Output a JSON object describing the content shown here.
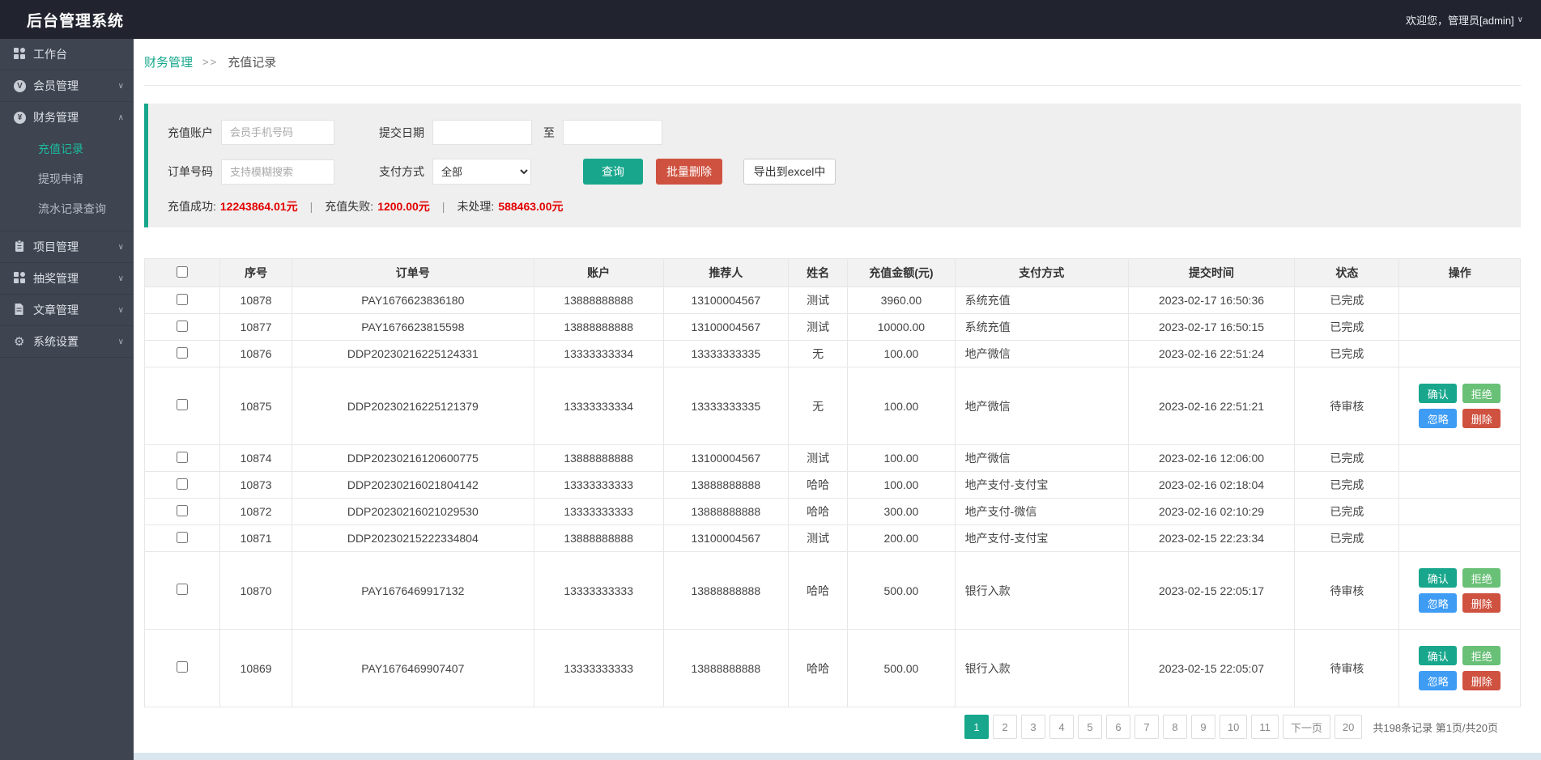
{
  "header": {
    "title": "后台管理系统",
    "welcome": "欢迎您，管理员[admin]"
  },
  "sidebar": {
    "items": [
      {
        "key": "workbench",
        "icon": "grid",
        "label": "工作台",
        "chevron": ""
      },
      {
        "key": "members",
        "icon": "member-circle",
        "label": "会员管理",
        "chevron": "down"
      },
      {
        "key": "finance",
        "icon": "yen-circle",
        "label": "财务管理",
        "chevron": "up",
        "children": [
          {
            "key": "recharge-records",
            "label": "充值记录",
            "active": true
          },
          {
            "key": "withdraw-requests",
            "label": "提现申请",
            "active": false
          },
          {
            "key": "flow-records",
            "label": "流水记录查询",
            "active": false
          }
        ]
      },
      {
        "key": "projects",
        "icon": "clipboard",
        "label": "项目管理",
        "chevron": "down"
      },
      {
        "key": "lottery",
        "icon": "grid",
        "label": "抽奖管理",
        "chevron": "down"
      },
      {
        "key": "articles",
        "icon": "document",
        "label": "文章管理",
        "chevron": "down"
      },
      {
        "key": "settings",
        "icon": "gear",
        "label": "系统设置",
        "chevron": "down"
      }
    ]
  },
  "breadcrumb": {
    "parent": "财务管理",
    "separator": ">>",
    "current": "充值记录"
  },
  "filters": {
    "recharge_account_label": "充值账户",
    "recharge_account_placeholder": "会员手机号码",
    "submit_date_label": "提交日期",
    "to_label": "至",
    "order_no_label": "订单号码",
    "order_no_placeholder": "支持模糊搜索",
    "pay_method_label": "支付方式",
    "pay_method_value": "全部",
    "search_button": "查询",
    "batch_delete_button": "批量删除",
    "export_button": "导出到excel中"
  },
  "stats": {
    "success_label": "充值成功:",
    "success_value": "12243864.01元",
    "fail_label": "充值失败:",
    "fail_value": "1200.00元",
    "pending_label": "未处理:",
    "pending_value": "588463.00元",
    "divider": "|"
  },
  "table": {
    "headers": [
      "序号",
      "订单号",
      "账户",
      "推荐人",
      "姓名",
      "充值金额(元)",
      "支付方式",
      "提交时间",
      "状态",
      "操作"
    ],
    "action_labels": {
      "confirm": "确认",
      "reject": "拒绝",
      "ignore": "忽略",
      "delete": "删除"
    },
    "rows": [
      {
        "id": "10878",
        "order": "PAY1676623836180",
        "account": "13888888888",
        "referrer": "13100004567",
        "name": "测试",
        "amount": "3960.00",
        "method": "系统充值",
        "time": "2023-02-17 16:50:36",
        "status": "已完成",
        "actions": false
      },
      {
        "id": "10877",
        "order": "PAY1676623815598",
        "account": "13888888888",
        "referrer": "13100004567",
        "name": "测试",
        "amount": "10000.00",
        "method": "系统充值",
        "time": "2023-02-17 16:50:15",
        "status": "已完成",
        "actions": false
      },
      {
        "id": "10876",
        "order": "DDP20230216225124331",
        "account": "13333333334",
        "referrer": "13333333335",
        "name": "无",
        "amount": "100.00",
        "method": "地产微信",
        "time": "2023-02-16 22:51:24",
        "status": "已完成",
        "actions": false
      },
      {
        "id": "10875",
        "order": "DDP20230216225121379",
        "account": "13333333334",
        "referrer": "13333333335",
        "name": "无",
        "amount": "100.00",
        "method": "地产微信",
        "time": "2023-02-16 22:51:21",
        "status": "待审核",
        "actions": true
      },
      {
        "id": "10874",
        "order": "DDP20230216120600775",
        "account": "13888888888",
        "referrer": "13100004567",
        "name": "测试",
        "amount": "100.00",
        "method": "地产微信",
        "time": "2023-02-16 12:06:00",
        "status": "已完成",
        "actions": false
      },
      {
        "id": "10873",
        "order": "DDP20230216021804142",
        "account": "13333333333",
        "referrer": "13888888888",
        "name": "哈哈",
        "amount": "100.00",
        "method": "地产支付-支付宝",
        "time": "2023-02-16 02:18:04",
        "status": "已完成",
        "actions": false
      },
      {
        "id": "10872",
        "order": "DDP20230216021029530",
        "account": "13333333333",
        "referrer": "13888888888",
        "name": "哈哈",
        "amount": "300.00",
        "method": "地产支付-微信",
        "time": "2023-02-16 02:10:29",
        "status": "已完成",
        "actions": false
      },
      {
        "id": "10871",
        "order": "DDP20230215222334804",
        "account": "13888888888",
        "referrer": "13100004567",
        "name": "测试",
        "amount": "200.00",
        "method": "地产支付-支付宝",
        "time": "2023-02-15 22:23:34",
        "status": "已完成",
        "actions": false
      },
      {
        "id": "10870",
        "order": "PAY1676469917132",
        "account": "13333333333",
        "referrer": "13888888888",
        "name": "哈哈",
        "amount": "500.00",
        "method": "银行入款",
        "time": "2023-02-15 22:05:17",
        "status": "待审核",
        "actions": true
      },
      {
        "id": "10869",
        "order": "PAY1676469907407",
        "account": "13333333333",
        "referrer": "13888888888",
        "name": "哈哈",
        "amount": "500.00",
        "method": "银行入款",
        "time": "2023-02-15 22:05:07",
        "status": "待审核",
        "actions": true
      }
    ]
  },
  "pagination": {
    "pages": [
      "1",
      "2",
      "3",
      "4",
      "5",
      "6",
      "7",
      "8",
      "9",
      "10",
      "11"
    ],
    "active": "1",
    "next_label": "下一页",
    "last_page": "20",
    "summary": "共198条记录 第1页/共20页"
  },
  "colors": {
    "accent_teal": "#18a78c",
    "danger_red": "#cf5240",
    "success_green": "#69c077",
    "info_blue": "#3e9cf5",
    "stat_red": "#e30000",
    "header_bg": "#21242e",
    "sidebar_bg": "#3e4450"
  }
}
